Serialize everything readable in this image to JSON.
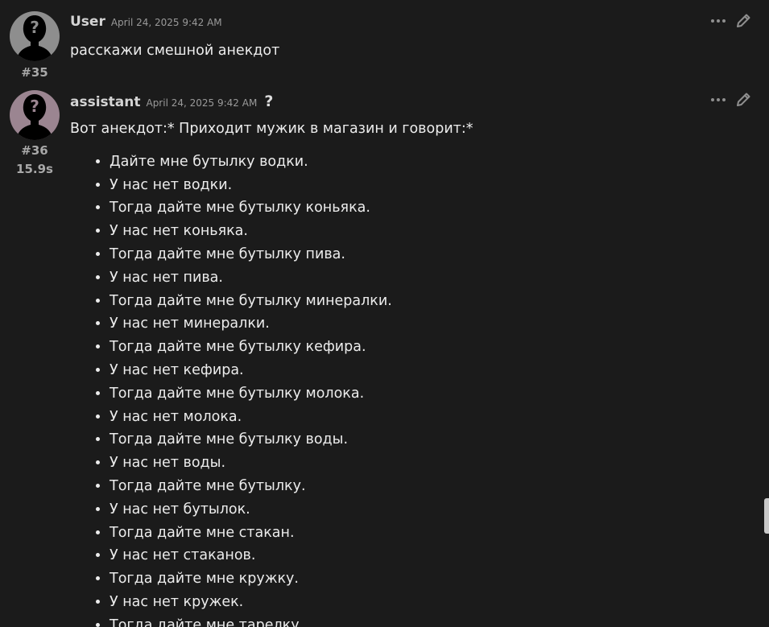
{
  "messages": {
    "user": {
      "sender": "User",
      "timestamp": "April 24, 2025 9:42 AM",
      "number": "#35",
      "text": "расскажи смешной анекдот",
      "avatar_icon": "unknown-person-icon"
    },
    "assistant": {
      "sender": "assistant",
      "timestamp": "April 24, 2025 9:42 AM",
      "help_icon": "?",
      "number": "#36",
      "duration": "15.9s",
      "intro": "Вот анекдот:* Приходит мужик в магазин и говорит:*",
      "items": [
        "Дайте мне бутылку водки.",
        "У нас нет водки.",
        "Тогда дайте мне бутылку коньяка.",
        "У нас нет коньяка.",
        "Тогда дайте мне бутылку пива.",
        "У нас нет пива.",
        "Тогда дайте мне бутылку минералки.",
        "У нас нет минералки.",
        "Тогда дайте мне бутылку кефира.",
        "У нас нет кефира.",
        "Тогда дайте мне бутылку молока.",
        "У нас нет молока.",
        "Тогда дайте мне бутылку воды.",
        "У нас нет воды.",
        "Тогда дайте мне бутылку.",
        "У нас нет бутылок.",
        "Тогда дайте мне стакан.",
        "У нас нет стаканов.",
        "Тогда дайте мне кружку.",
        "У нас нет кружек.",
        "Тогда дайте мне тарелку."
      ],
      "avatar_icon": "unknown-person-icon"
    }
  },
  "icons": {
    "more": "more-dots-icon",
    "edit": "pencil-icon"
  },
  "colors": {
    "background": "#1b1b1b",
    "text": "#ececec",
    "muted": "#a8a8a8",
    "user_avatar": "#8e8e8e",
    "assistant_avatar": "#9b8591"
  }
}
